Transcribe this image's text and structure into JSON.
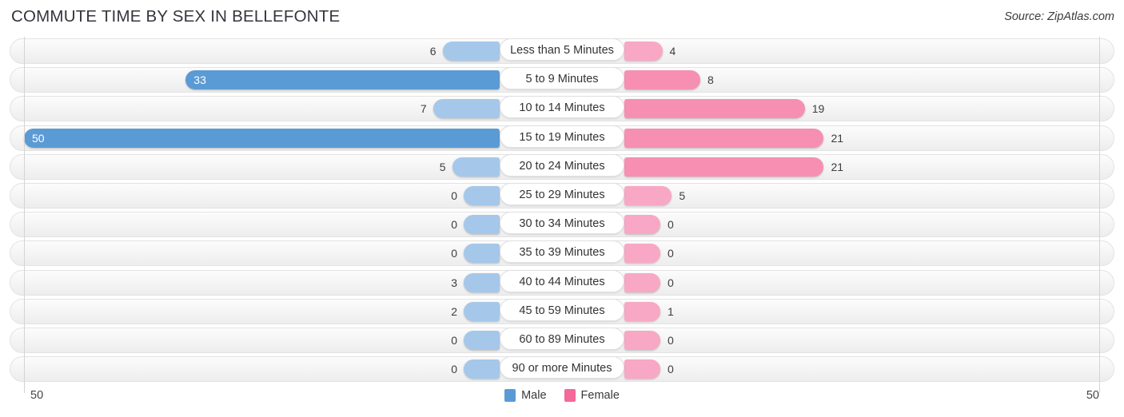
{
  "header": {
    "title": "COMMUTE TIME BY SEX IN BELLEFONTE",
    "source": "Source: ZipAtlas.com"
  },
  "legend": {
    "items": [
      {
        "label": "Male",
        "color": "#5b9bd5"
      },
      {
        "label": "Female",
        "color": "#f4689a"
      }
    ]
  },
  "axis": {
    "left_label": "50",
    "right_label": "50",
    "max": 50
  },
  "colors": {
    "male_light": "#a5c8ea",
    "male_mid": "#8ab9e3",
    "male_strong": "#5b9bd5",
    "female_light": "#f8a8c4",
    "female_mid": "#f78fb3",
    "female_strong": "#f4689a",
    "track": "#f4f4f4",
    "gridline": "#d4d4d4"
  },
  "chart_data": {
    "type": "bar",
    "title": "COMMUTE TIME BY SEX IN BELLEFONTE",
    "subtitle": "",
    "orientation": "horizontal-diverging",
    "xlabel": "",
    "ylabel": "",
    "xlim": [
      50,
      50
    ],
    "grid": true,
    "legend_position": "bottom-center",
    "categories": [
      "Less than 5 Minutes",
      "5 to 9 Minutes",
      "10 to 14 Minutes",
      "15 to 19 Minutes",
      "20 to 24 Minutes",
      "25 to 29 Minutes",
      "30 to 34 Minutes",
      "35 to 39 Minutes",
      "40 to 44 Minutes",
      "45 to 59 Minutes",
      "60 to 89 Minutes",
      "90 or more Minutes"
    ],
    "series": [
      {
        "name": "Male",
        "values": [
          6,
          33,
          7,
          50,
          5,
          0,
          0,
          0,
          3,
          2,
          0,
          0
        ]
      },
      {
        "name": "Female",
        "values": [
          4,
          8,
          19,
          21,
          21,
          5,
          0,
          0,
          0,
          1,
          0,
          0
        ]
      }
    ]
  }
}
